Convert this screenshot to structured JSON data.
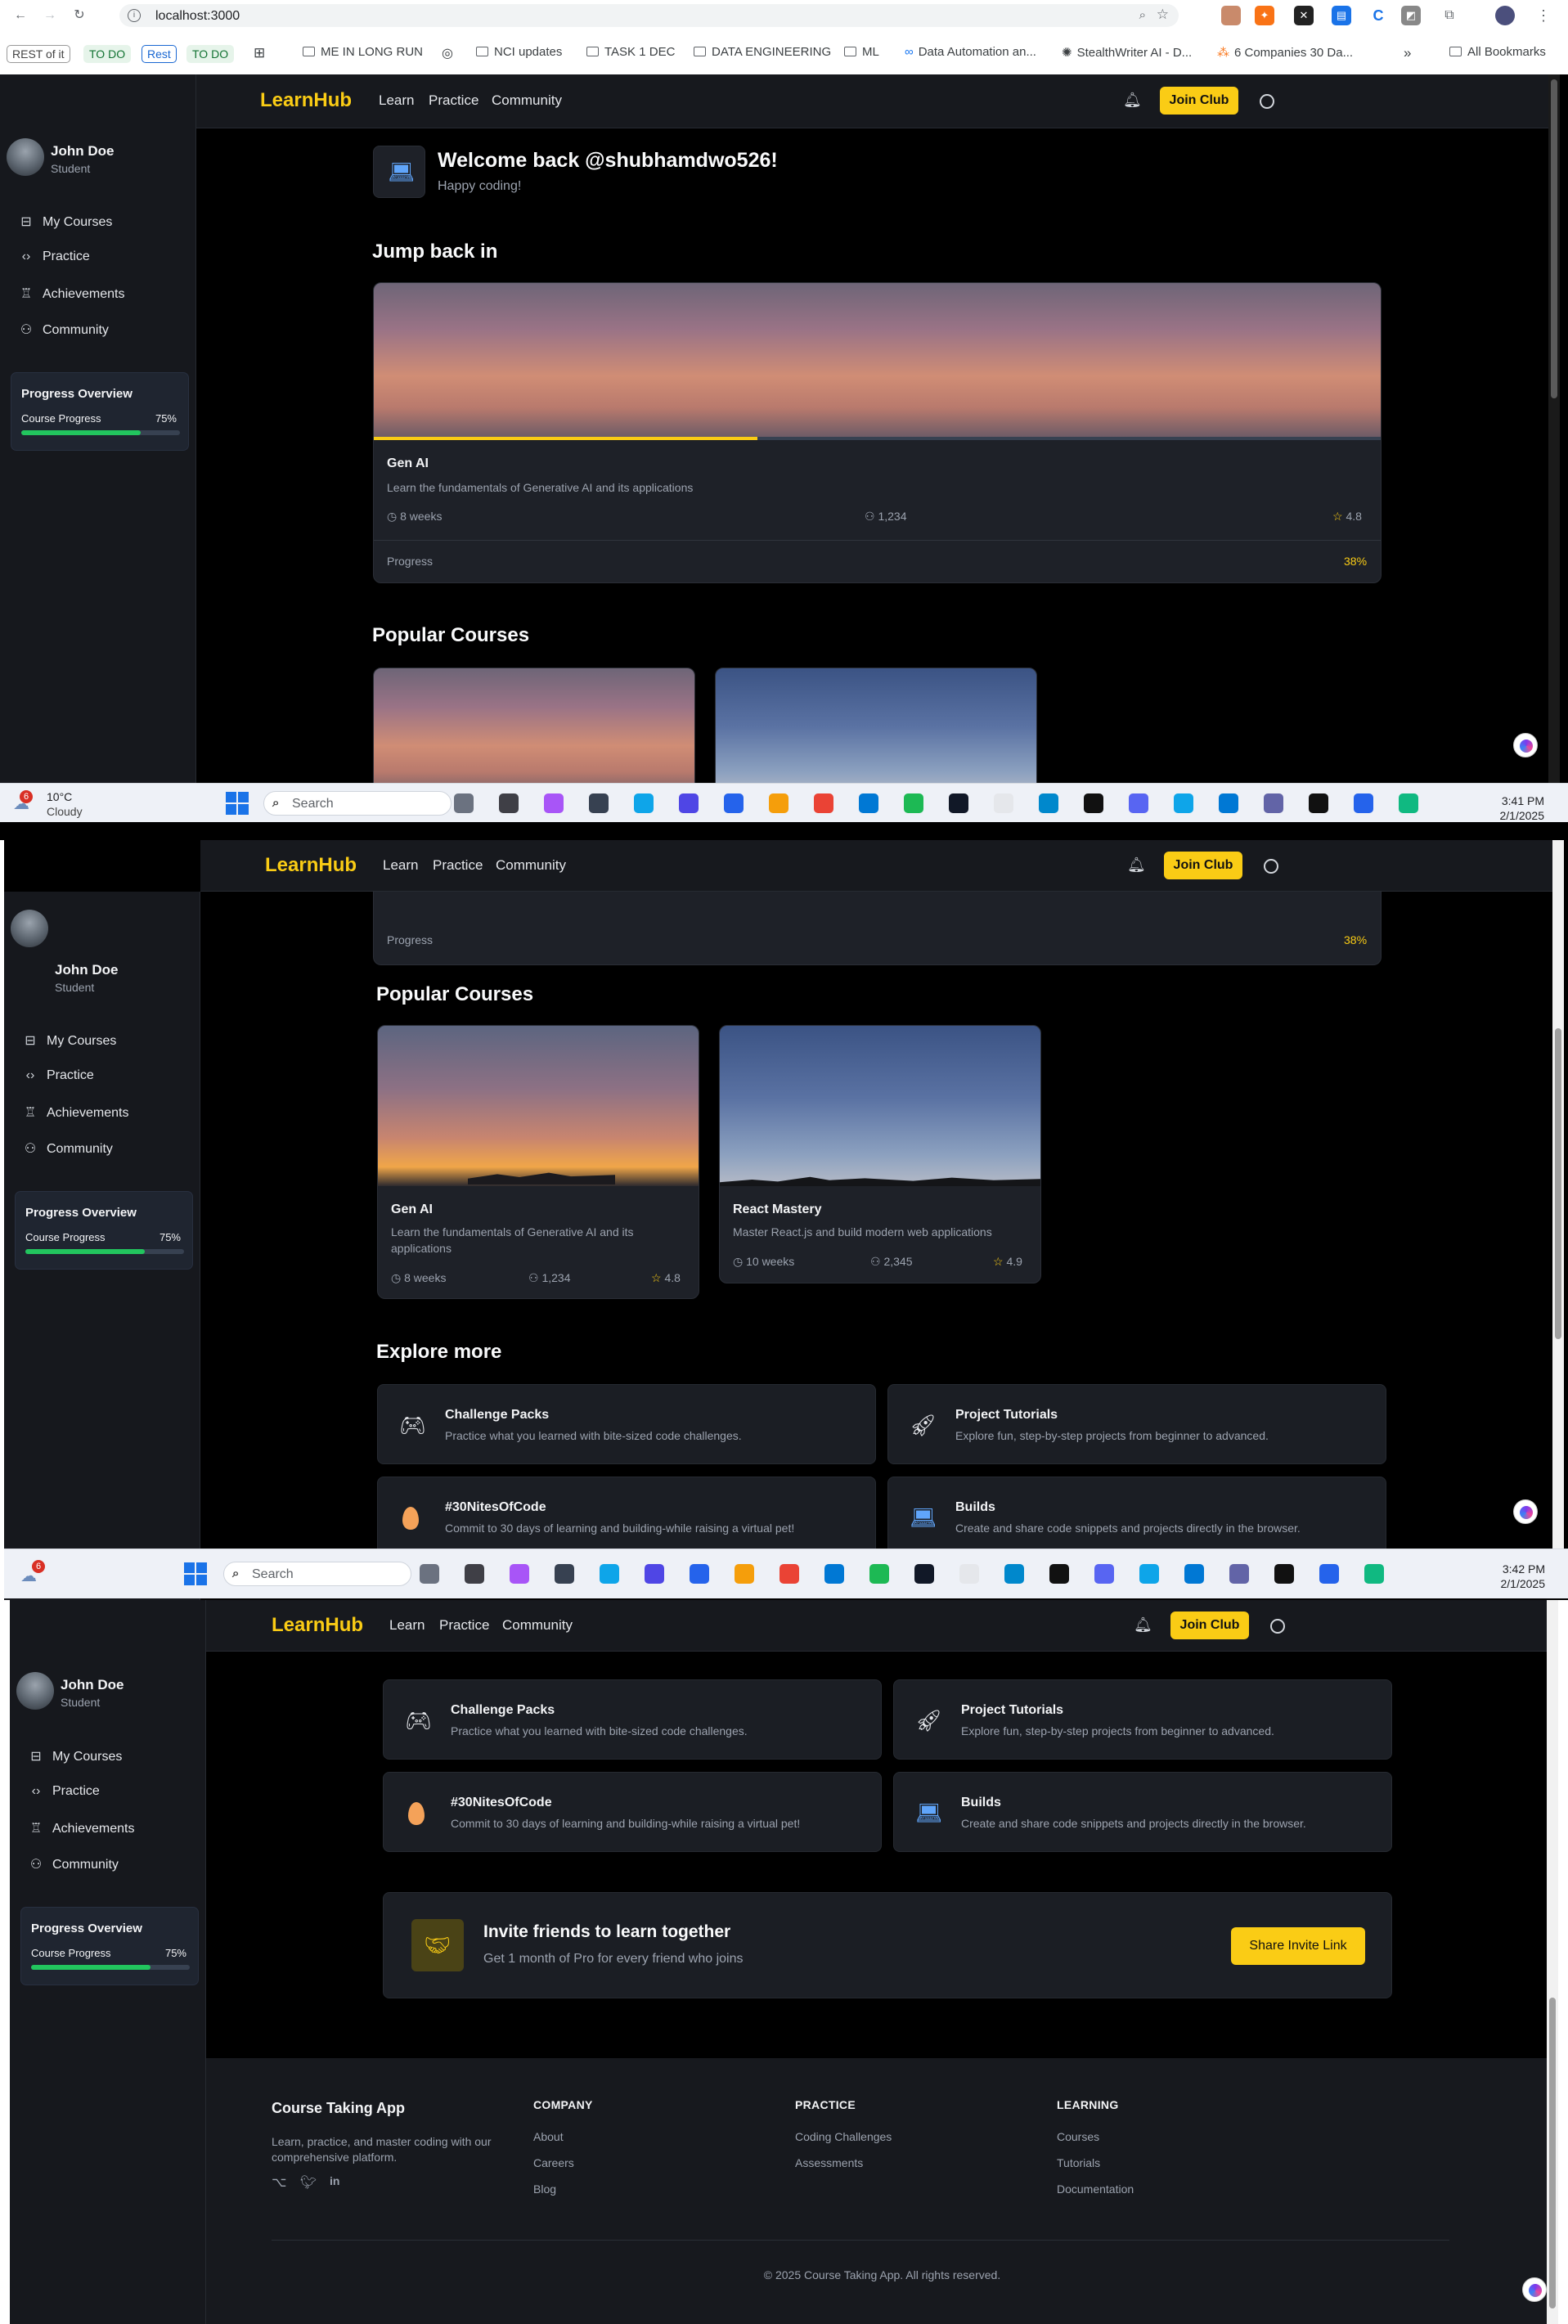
{
  "browser": {
    "url": "localhost:3000",
    "bookmarks": [
      "REST of it",
      "TO DO",
      "Rest",
      "TO DO",
      "ME IN LONG RUN",
      "NCI updates",
      "TASK 1 DEC",
      "DATA ENGINEERING",
      "ML",
      "Data Automation an...",
      "StealthWriter AI - D...",
      "6 Companies 30 Da...",
      "All Bookmarks"
    ]
  },
  "header": {
    "logo": "LearnHub",
    "nav": [
      "Learn",
      "Practice",
      "Community"
    ],
    "join_label": "Join Club"
  },
  "sidebar": {
    "user_name": "John Doe",
    "user_role": "Student",
    "items": [
      {
        "label": "My Courses",
        "icon": "book-icon"
      },
      {
        "label": "Practice",
        "icon": "code-icon"
      },
      {
        "label": "Achievements",
        "icon": "trophy-icon"
      },
      {
        "label": "Community",
        "icon": "users-icon"
      }
    ],
    "progress": {
      "title": "Progress Overview",
      "label": "Course Progress",
      "value": "75%",
      "fraction": 0.75
    }
  },
  "welcome": {
    "title": "Welcome back @shubhamdwo526!",
    "subtitle": "Happy coding!"
  },
  "jump_back": {
    "heading": "Jump back in",
    "course": {
      "title": "Gen AI",
      "description": "Learn the fundamentals of Generative AI and its applications",
      "duration": "8 weeks",
      "students": "1,234",
      "rating": "4.8",
      "progress_label": "Progress",
      "progress_value": "38%",
      "progress_fraction": 0.38
    }
  },
  "popular": {
    "heading": "Popular Courses",
    "courses": [
      {
        "title": "Gen AI",
        "description": "Learn the fundamentals of Generative AI and its applications",
        "duration": "8 weeks",
        "students": "1,234",
        "rating": "4.8"
      },
      {
        "title": "React Mastery",
        "description": "Master React.js and build modern web applications",
        "duration": "10 weeks",
        "students": "2,345",
        "rating": "4.9"
      }
    ]
  },
  "explore": {
    "heading": "Explore more",
    "items": [
      {
        "title": "Challenge Packs",
        "description": "Practice what you learned with bite-sized code challenges.",
        "icon": "game-controller-icon"
      },
      {
        "title": "Project Tutorials",
        "description": "Explore fun, step-by-step projects from beginner to advanced.",
        "icon": "rocket-icon"
      },
      {
        "title": "#30NitesOfCode",
        "description": "Commit to 30 days of learning and building-while raising a virtual pet!",
        "icon": "egg-icon"
      },
      {
        "title": "Builds",
        "description": "Create and share code snippets and projects directly in the browser.",
        "icon": "laptop-icon"
      }
    ]
  },
  "invite": {
    "title": "Invite friends to learn together",
    "subtitle": "Get 1 month of Pro for every friend who joins",
    "button": "Share Invite Link"
  },
  "footer": {
    "brand": "Course Taking App",
    "tagline_1": "Learn, practice, and master coding with our",
    "tagline_2": "comprehensive platform.",
    "columns": [
      {
        "heading": "COMPANY",
        "links": [
          "About",
          "Careers",
          "Blog"
        ]
      },
      {
        "heading": "PRACTICE",
        "links": [
          "Coding Challenges",
          "Assessments"
        ]
      },
      {
        "heading": "LEARNING",
        "links": [
          "Courses",
          "Tutorials",
          "Documentation"
        ]
      }
    ],
    "copyright": "© 2025 Course Taking App. All rights reserved."
  },
  "taskbar": {
    "weather_temp": "10°C",
    "weather_desc": "Cloudy",
    "weather_badge": "6",
    "search": "Search",
    "clock1_time": "3:41 PM",
    "clock1_date": "2/1/2025",
    "clock2_time": "3:42 PM",
    "clock2_date": "2/1/2025"
  },
  "colors": {
    "accent": "#facc15",
    "progress_green": "#22c55e",
    "bg": "#000000",
    "surface": "#1e2128"
  }
}
